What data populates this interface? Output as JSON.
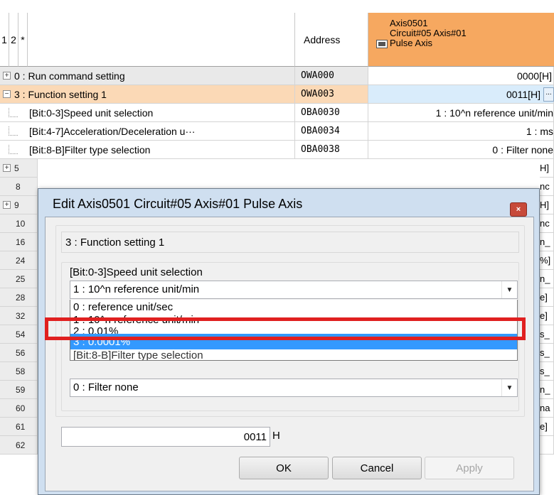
{
  "grid": {
    "header": {
      "col1": "1",
      "col2": "2",
      "col3": "*",
      "address": "Address",
      "axis_line1": "Axis0501",
      "axis_line2": "Circuit#05 Axis#01",
      "axis_line3": "Pulse Axis"
    },
    "rows": [
      {
        "name": "0 : Run command setting",
        "address": "OWA000",
        "value": "0000[H]"
      },
      {
        "name": "3 : Function setting 1",
        "address": "OWA003",
        "value": "0011[H]"
      },
      {
        "name": "[Bit:0-3]Speed unit selection",
        "address": "OBA0030",
        "value": "1 : 10^n reference unit/min"
      },
      {
        "name": "[Bit:4-7]Acceleration/Deceleration u···",
        "address": "OBA0034",
        "value": "1 : ms"
      },
      {
        "name": "[Bit:8-B]Filter type selection",
        "address": "OBA0038",
        "value": "0 : Filter none"
      }
    ],
    "partial_row_nums": [
      "5",
      "8",
      "9",
      "10",
      "16",
      "24",
      "25",
      "28",
      "32",
      "54",
      "56",
      "58",
      "59",
      "60",
      "61",
      "62"
    ],
    "partial_values": [
      "H]",
      "nc",
      "H]",
      "nc",
      "n_",
      "%]",
      "n_",
      "e]",
      "e]",
      "s_",
      "s_",
      "s_",
      "n_",
      "na",
      "e]",
      ""
    ],
    "expand_plus": "+",
    "expand_minus": "−"
  },
  "dialog": {
    "title": "Edit  Axis0501  Circuit#05 Axis#01  Pulse Axis",
    "close_icon": "×",
    "section_label": "3 : Function setting 1",
    "group_label": "[Bit:0-3]Speed unit selection",
    "combo_value": "1 : 10^n reference unit/min",
    "dropdown_options": [
      "0 : reference unit/sec",
      "1 : 10^n reference unit/min",
      "2 : 0.01%",
      "3 : 0.0001%"
    ],
    "selected_option_index": 3,
    "hidden_group_label": "[Bit:8-B]Filter type selection",
    "filter_combo_value": "0 : Filter none",
    "hex_value": "0011",
    "hex_suffix": "H",
    "ok_label": "OK",
    "cancel_label": "Cancel",
    "apply_label": "Apply"
  },
  "colors": {
    "header_orange": "#f6a860",
    "row_highlight": "#fbd9b6",
    "selection_blue": "#3399ff",
    "annotation_red": "#e02020",
    "dialog_frame": "#cfdff0"
  }
}
